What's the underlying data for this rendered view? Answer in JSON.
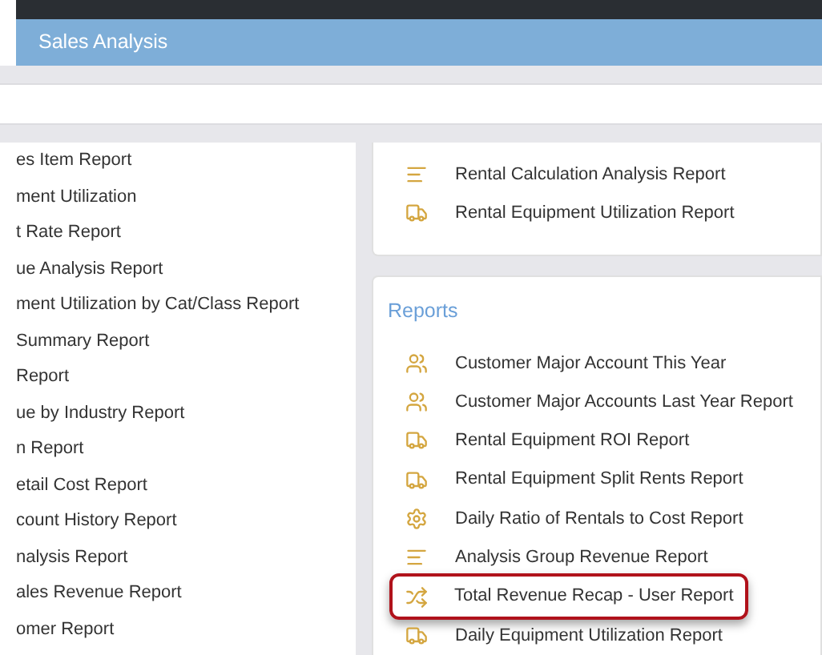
{
  "window": {
    "title": "Sales Analysis"
  },
  "left_list": {
    "items": [
      {
        "label": "es Item Report"
      },
      {
        "label": "ment Utilization"
      },
      {
        "label": "t Rate Report"
      },
      {
        "label": "ue Analysis Report"
      },
      {
        "label": "ment Utilization by Cat/Class Report"
      },
      {
        "label": "Summary Report"
      },
      {
        "label": "Report"
      },
      {
        "label": "ue by Industry Report"
      },
      {
        "label": "n Report"
      },
      {
        "label": "etail Cost Report"
      },
      {
        "label": "count History Report"
      },
      {
        "label": "nalysis Report"
      },
      {
        "label": "ales Revenue Report"
      },
      {
        "label": "omer Report"
      }
    ]
  },
  "upper_card": {
    "items": [
      {
        "kind": "chart",
        "label": "Rental Calculation Analysis Report",
        "highlighted": false
      },
      {
        "kind": "truck",
        "label": "Rental Equipment Utilization Report",
        "highlighted": false
      }
    ]
  },
  "reports_card": {
    "heading": "Reports",
    "items": [
      {
        "kind": "users",
        "label": "Customer Major Account This Year",
        "highlighted": false
      },
      {
        "kind": "users",
        "label": "Customer Major Accounts Last Year Report",
        "highlighted": false
      },
      {
        "kind": "truck",
        "label": "Rental Equipment ROI Report",
        "highlighted": false
      },
      {
        "kind": "truck",
        "label": "Rental Equipment Split Rents Report",
        "highlighted": false
      },
      {
        "kind": "gear",
        "label": "Daily Ratio of Rentals to Cost Report",
        "highlighted": false
      },
      {
        "kind": "chart",
        "label": "Analysis Group Revenue Report",
        "highlighted": false
      },
      {
        "kind": "shuffle",
        "label": "Total Revenue Recap - User Report",
        "highlighted": true
      },
      {
        "kind": "truck",
        "label": "Daily Equipment Utilization Report",
        "highlighted": false
      }
    ]
  }
}
